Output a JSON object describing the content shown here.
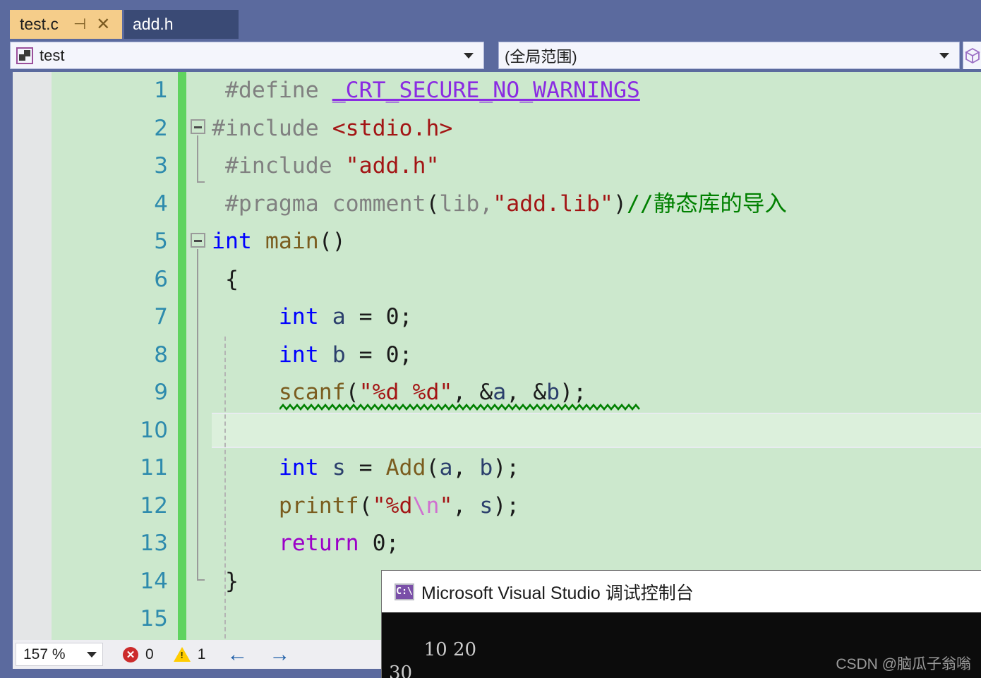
{
  "tabs": [
    {
      "label": "test.c",
      "active": true,
      "pin_icon": "pin-icon",
      "close_icon": "close-icon"
    },
    {
      "label": "add.h",
      "active": false
    }
  ],
  "navbar": {
    "project_icon": "project-puzzle-icon",
    "project_value": "test",
    "scope_value": "(全局范围)",
    "dropdown_icon": "chevron-down-icon",
    "cube_icon": "cube-icon"
  },
  "editor": {
    "language": "c",
    "current_line": 10,
    "lines": [
      {
        "num": "1",
        "tokens": [
          {
            "t": " ",
            "c": "t-plain"
          },
          {
            "t": "#define ",
            "c": "t-pre"
          },
          {
            "t": "_CRT_SECURE_NO_WARNINGS",
            "c": "t-macro"
          }
        ]
      },
      {
        "num": "2",
        "tokens": [
          {
            "t": "#include ",
            "c": "t-pre"
          },
          {
            "t": "<stdio.h>",
            "c": "t-str"
          }
        ]
      },
      {
        "num": "3",
        "tokens": [
          {
            "t": " ",
            "c": "t-plain"
          },
          {
            "t": "#include ",
            "c": "t-pre"
          },
          {
            "t": "\"add.h\"",
            "c": "t-str"
          }
        ]
      },
      {
        "num": "4",
        "tokens": [
          {
            "t": " ",
            "c": "t-plain"
          },
          {
            "t": "#pragma comment",
            "c": "t-pre"
          },
          {
            "t": "(",
            "c": "t-plain"
          },
          {
            "t": "lib,",
            "c": "t-pre"
          },
          {
            "t": "\"add.lib\"",
            "c": "t-str"
          },
          {
            "t": ")",
            "c": "t-plain"
          },
          {
            "t": "//静态库的导入",
            "c": "t-cmt"
          }
        ]
      },
      {
        "num": "5",
        "tokens": [
          {
            "t": "int",
            "c": "t-kw"
          },
          {
            "t": " ",
            "c": "t-plain"
          },
          {
            "t": "main",
            "c": "t-fn"
          },
          {
            "t": "()",
            "c": "t-plain"
          }
        ]
      },
      {
        "num": "6",
        "tokens": [
          {
            "t": " {",
            "c": "t-plain"
          }
        ]
      },
      {
        "num": "7",
        "tokens": [
          {
            "t": "     ",
            "c": "t-plain"
          },
          {
            "t": "int",
            "c": "t-kw"
          },
          {
            "t": " ",
            "c": "t-plain"
          },
          {
            "t": "a",
            "c": "t-var"
          },
          {
            "t": " = ",
            "c": "t-plain"
          },
          {
            "t": "0",
            "c": "t-num"
          },
          {
            "t": ";",
            "c": "t-plain"
          }
        ]
      },
      {
        "num": "8",
        "tokens": [
          {
            "t": "     ",
            "c": "t-plain"
          },
          {
            "t": "int",
            "c": "t-kw"
          },
          {
            "t": " ",
            "c": "t-plain"
          },
          {
            "t": "b",
            "c": "t-var"
          },
          {
            "t": " = ",
            "c": "t-plain"
          },
          {
            "t": "0",
            "c": "t-num"
          },
          {
            "t": ";",
            "c": "t-plain"
          }
        ]
      },
      {
        "num": "9",
        "tokens": [
          {
            "t": "     ",
            "c": "t-plain"
          },
          {
            "t": "scanf",
            "c": "t-fn"
          },
          {
            "t": "(",
            "c": "t-plain"
          },
          {
            "t": "\"%d %d\"",
            "c": "t-str"
          },
          {
            "t": ", &",
            "c": "t-plain"
          },
          {
            "t": "a",
            "c": "t-var"
          },
          {
            "t": ", &",
            "c": "t-plain"
          },
          {
            "t": "b",
            "c": "t-var"
          },
          {
            "t": ");",
            "c": "t-plain"
          }
        ]
      },
      {
        "num": "10",
        "tokens": [
          {
            "t": "",
            "c": "t-plain"
          }
        ]
      },
      {
        "num": "11",
        "tokens": [
          {
            "t": "     ",
            "c": "t-plain"
          },
          {
            "t": "int",
            "c": "t-kw"
          },
          {
            "t": " ",
            "c": "t-plain"
          },
          {
            "t": "s",
            "c": "t-var"
          },
          {
            "t": " = ",
            "c": "t-plain"
          },
          {
            "t": "Add",
            "c": "t-fn"
          },
          {
            "t": "(",
            "c": "t-plain"
          },
          {
            "t": "a",
            "c": "t-var"
          },
          {
            "t": ", ",
            "c": "t-plain"
          },
          {
            "t": "b",
            "c": "t-var"
          },
          {
            "t": ");",
            "c": "t-plain"
          }
        ]
      },
      {
        "num": "12",
        "tokens": [
          {
            "t": "     ",
            "c": "t-plain"
          },
          {
            "t": "printf",
            "c": "t-fn"
          },
          {
            "t": "(",
            "c": "t-plain"
          },
          {
            "t": "\"%d",
            "c": "t-str"
          },
          {
            "t": "\\n",
            "c": "t-esc"
          },
          {
            "t": "\"",
            "c": "t-str"
          },
          {
            "t": ", ",
            "c": "t-plain"
          },
          {
            "t": "s",
            "c": "t-var"
          },
          {
            "t": ");",
            "c": "t-plain"
          }
        ]
      },
      {
        "num": "13",
        "tokens": [
          {
            "t": "     ",
            "c": "t-plain"
          },
          {
            "t": "return",
            "c": "t-kw2"
          },
          {
            "t": " ",
            "c": "t-plain"
          },
          {
            "t": "0",
            "c": "t-num"
          },
          {
            "t": ";",
            "c": "t-plain"
          }
        ]
      },
      {
        "num": "14",
        "tokens": [
          {
            "t": " }",
            "c": "t-plain"
          }
        ]
      },
      {
        "num": "15",
        "tokens": [
          {
            "t": "",
            "c": "t-plain"
          }
        ]
      }
    ]
  },
  "statusbar": {
    "zoom_value": "157 %",
    "dropdown_icon": "chevron-down-icon",
    "error_icon": "error-icon",
    "error_count": "0",
    "warning_icon": "warning-icon",
    "warning_count": "1",
    "back_icon": "arrow-left-icon",
    "forward_icon": "arrow-right-icon",
    "back_glyph": "←",
    "forward_glyph": "→"
  },
  "console": {
    "icon": "console-icon",
    "icon_text": "C:\\",
    "title": "Microsoft Visual Studio 调试控制台",
    "output": "10 20\n30",
    "watermark": "CSDN @脑瓜子翁嗡"
  },
  "colors": {
    "chrome": "#5b6a9e",
    "editor_bg": "#cce8cd",
    "active_tab": "#f5cd8a",
    "inactive_tab": "#3a4a75",
    "change_bar": "#5fd35f",
    "linenum": "#2e8bad",
    "keyword": "#0000ff",
    "string": "#a31515",
    "comment": "#008000",
    "macro": "#8a2be2"
  }
}
